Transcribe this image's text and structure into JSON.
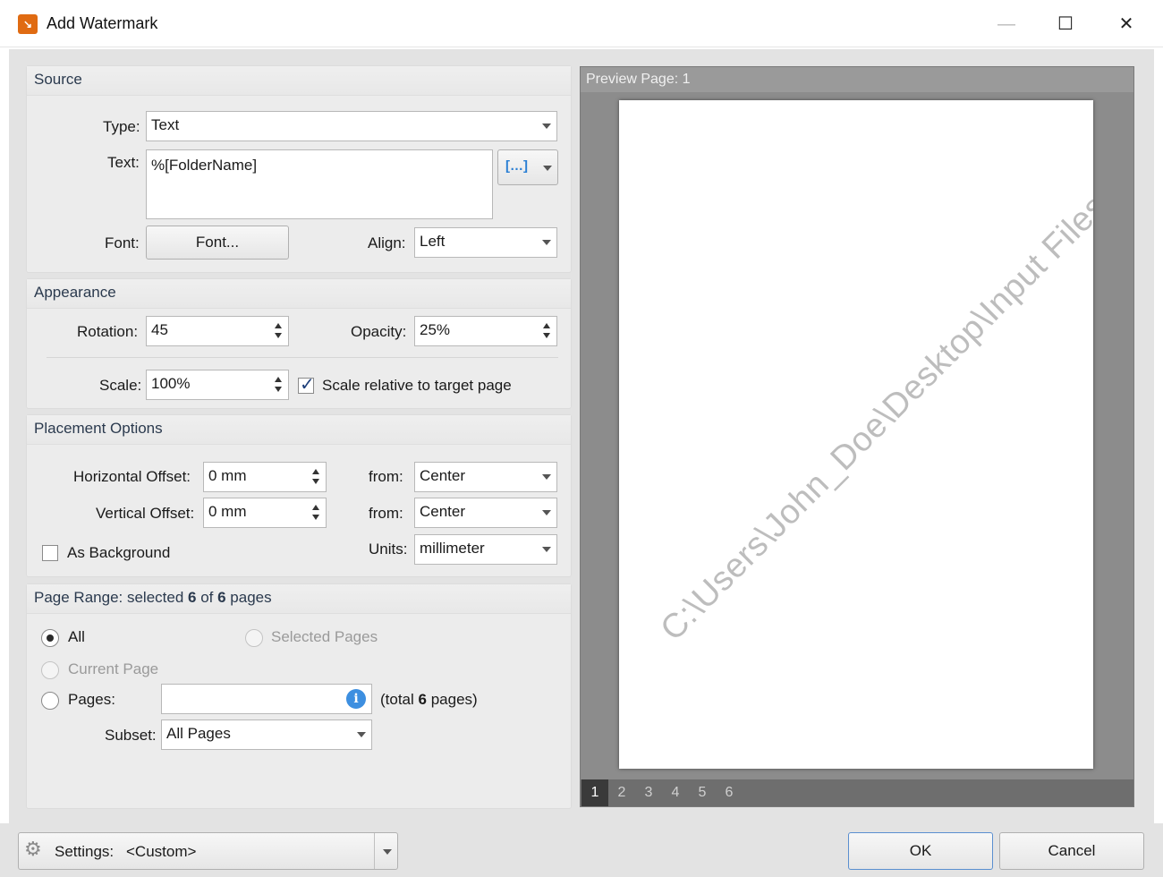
{
  "window": {
    "title": "Add Watermark",
    "minimize_glyph": "—",
    "maximize_glyph": "☐",
    "close_glyph": "✕",
    "app_icon": "pdf-app-icon"
  },
  "source": {
    "header": "Source",
    "type_label": "Type:",
    "type_value": "Text",
    "text_label": "Text:",
    "text_value": "%[FolderName]",
    "macro_button_glyph": "[…]",
    "font_label": "Font:",
    "font_button": "Font...",
    "align_label": "Align:",
    "align_value": "Left"
  },
  "appearance": {
    "header": "Appearance",
    "rotation_label": "Rotation:",
    "rotation_value": "45",
    "opacity_label": "Opacity:",
    "opacity_value": "25%",
    "scale_label": "Scale:",
    "scale_value": "100%",
    "scale_relative_label": "Scale relative to target page",
    "scale_relative_checked": true
  },
  "placement": {
    "header": "Placement Options",
    "h_offset_label": "Horizontal Offset:",
    "h_offset_value": "0 mm",
    "h_from_label": "from:",
    "h_from_value": "Center",
    "v_offset_label": "Vertical Offset:",
    "v_offset_value": "0 mm",
    "v_from_label": "from:",
    "v_from_value": "Center",
    "as_background_label": "As Background",
    "as_background_checked": false,
    "units_label": "Units:",
    "units_value": "millimeter"
  },
  "page_range": {
    "header_prefix": "Page Range: selected ",
    "selected_count": "6",
    "header_mid": " of ",
    "total_count": "6",
    "header_suffix": " pages",
    "all_label": "All",
    "selected_pages_label": "Selected Pages",
    "current_page_label": "Current Page",
    "pages_label": "Pages:",
    "pages_value": "",
    "info_glyph": "i",
    "total_prefix": "(total ",
    "total_value": "6",
    "total_suffix": " pages)",
    "subset_label": "Subset:",
    "subset_value": "All Pages"
  },
  "preview": {
    "header": "Preview Page: 1",
    "watermark_text": "C:\\Users\\John_Doe\\Desktop\\Input Files",
    "pages": [
      "1",
      "2",
      "3",
      "4",
      "5",
      "6"
    ],
    "current_page": "1"
  },
  "footer": {
    "settings_label": "Settings:",
    "settings_value": "<Custom>",
    "ok_label": "OK",
    "cancel_label": "Cancel"
  }
}
